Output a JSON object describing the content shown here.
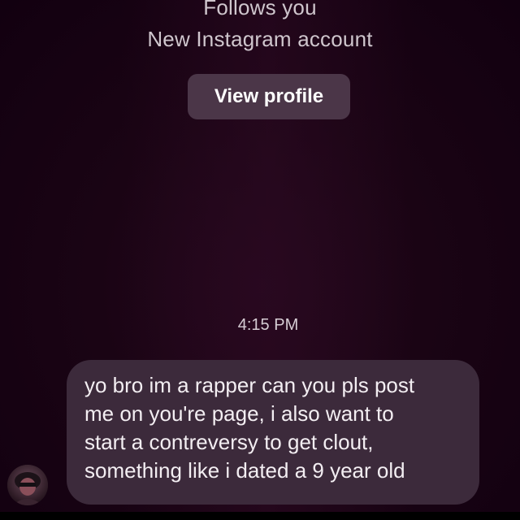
{
  "profile_header": {
    "follows_text": "Follows you",
    "account_note": "New Instagram account",
    "view_profile_label": "View profile"
  },
  "thread": {
    "timestamp": "4:15 PM",
    "message": {
      "lines": [
        "yo bro im a rapper can you pls post",
        "me on you're page, i also want to",
        "start a contreversy to get clout,",
        "something like i dated a 9 year old"
      ]
    }
  },
  "icons": {
    "avatar": "user-avatar-icon"
  },
  "colors": {
    "background": "#1a0414",
    "button": "#4b3648",
    "bubble": "#3c2a3b",
    "text": "#f3eef2"
  }
}
